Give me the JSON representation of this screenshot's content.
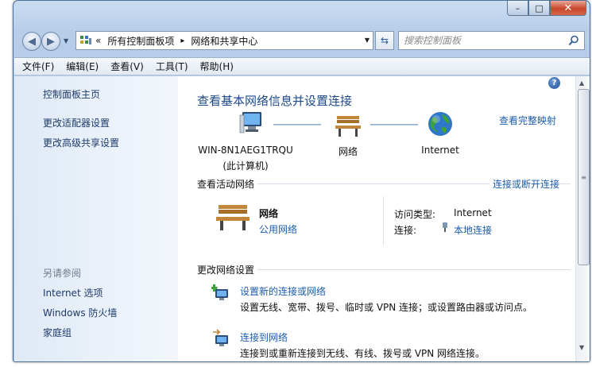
{
  "window": {
    "minimize_glyph": "–",
    "maximize_glyph": "□",
    "close_glyph": "✕"
  },
  "address": {
    "chevrons": "«",
    "breadcrumb": [
      "所有控制面板项",
      "网络和共享中心"
    ],
    "separator": "▸"
  },
  "search": {
    "placeholder": "搜索控制面板"
  },
  "menu": [
    "文件(F)",
    "编辑(E)",
    "查看(V)",
    "工具(T)",
    "帮助(H)"
  ],
  "sidebar": {
    "links": [
      "控制面板主页",
      "更改适配器设置",
      "更改高级共享设置"
    ],
    "see_also_title": "另请参阅",
    "see_also": [
      "Internet 选项",
      "Windows 防火墙",
      "家庭组"
    ]
  },
  "main": {
    "help": "?",
    "title": "查看基本网络信息并设置连接",
    "map_link": "查看完整映射",
    "nodes": [
      {
        "label": "WIN-8N1AEG1TRQU",
        "sublabel": "(此计算机)",
        "icon": "computer-icon"
      },
      {
        "label": "网络",
        "icon": "bench-icon"
      },
      {
        "label": "Internet",
        "icon": "globe-icon"
      }
    ],
    "active_networks": {
      "label": "查看活动网络",
      "connect_link": "连接或断开连接",
      "network_name": "网络",
      "network_type": "公用网络",
      "access_type_label": "访问类型:",
      "access_type_value": "Internet",
      "connections_label": "连接:",
      "connections_value": "本地连接"
    },
    "change_settings": {
      "label": "更改网络设置",
      "tasks": [
        {
          "title": "设置新的连接或网络",
          "desc": "设置无线、宽带、拨号、临时或 VPN 连接；或设置路由器或访问点。"
        },
        {
          "title": "连接到网络",
          "desc": "连接到或重新连接到无线、有线、拨号或 VPN 网络连接。"
        }
      ]
    }
  },
  "colors": {
    "link": "#1c5cad",
    "title": "#1e4a8a",
    "sidebar_bg": "#dfe9f6"
  }
}
